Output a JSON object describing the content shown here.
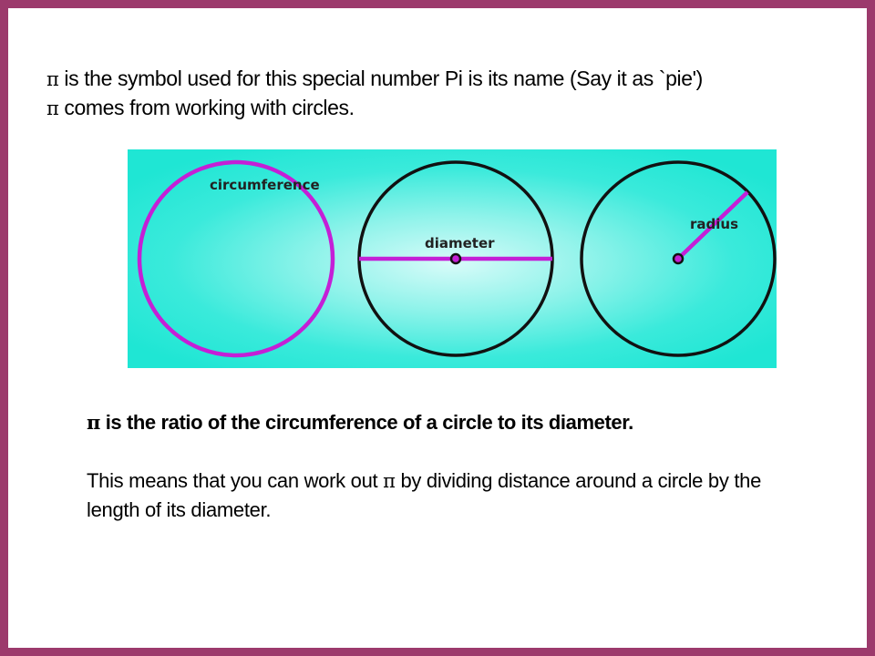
{
  "pi_symbol": "π",
  "intro": {
    "line1": " is the symbol used for this special number Pi is its name (Say it as `pie')",
    "line2": " comes from working with circles."
  },
  "illustration": {
    "circumference_label": "circumference",
    "diameter_label": "diameter",
    "radius_label": "radius",
    "colors": {
      "background": "#1fe6d4",
      "highlight": "#c41fd6",
      "outline": "#111111"
    }
  },
  "body": {
    "ratio_text": " is the ratio of the circumference of a circle to its diameter.",
    "means_prefix": "This means that you can work out ",
    "means_suffix": " by dividing distance around a circle by the length of its diameter."
  }
}
